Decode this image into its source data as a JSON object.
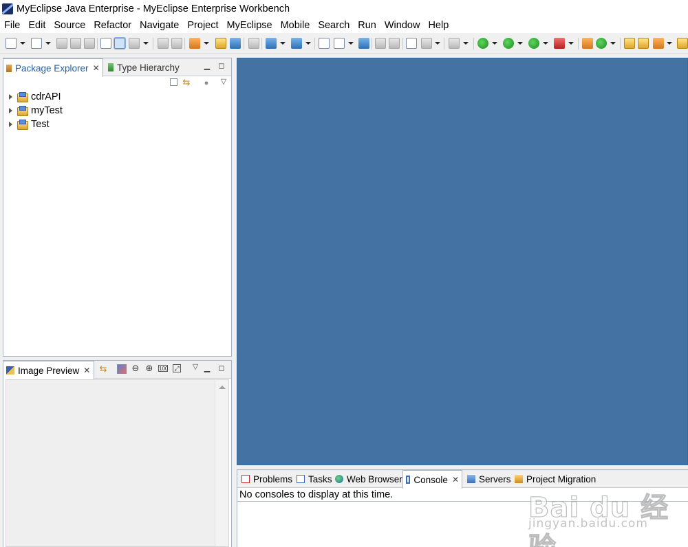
{
  "window": {
    "title": "MyEclipse Java Enterprise - MyEclipse Enterprise Workbench"
  },
  "menu": [
    "File",
    "Edit",
    "Source",
    "Refactor",
    "Navigate",
    "Project",
    "MyEclipse",
    "Mobile",
    "Search",
    "Run",
    "Window",
    "Help"
  ],
  "package_explorer": {
    "tabs": [
      {
        "label": "Package Explorer",
        "active": true,
        "closable": true
      },
      {
        "label": "Type Hierarchy",
        "active": false,
        "closable": false
      }
    ],
    "projects": [
      "cdrAPI",
      "myTest",
      "Test"
    ]
  },
  "image_preview": {
    "tab_label": "Image Preview"
  },
  "bottom_panel": {
    "tabs": [
      {
        "label": "Problems",
        "active": false
      },
      {
        "label": "Tasks",
        "active": false
      },
      {
        "label": "Web Browser",
        "active": false
      },
      {
        "label": "Console",
        "active": true,
        "closable": true
      },
      {
        "label": "Servers",
        "active": false
      },
      {
        "label": "Project Migration",
        "active": false
      }
    ],
    "console_message": "No consoles to display at this time."
  },
  "watermark": {
    "logo": "Bai du 经验",
    "url": "jingyan.baidu.com"
  },
  "colors": {
    "editor_background": "#4472a3",
    "panel_border": "#a9b4c2",
    "active_tab_text": "#1f5fa8"
  }
}
